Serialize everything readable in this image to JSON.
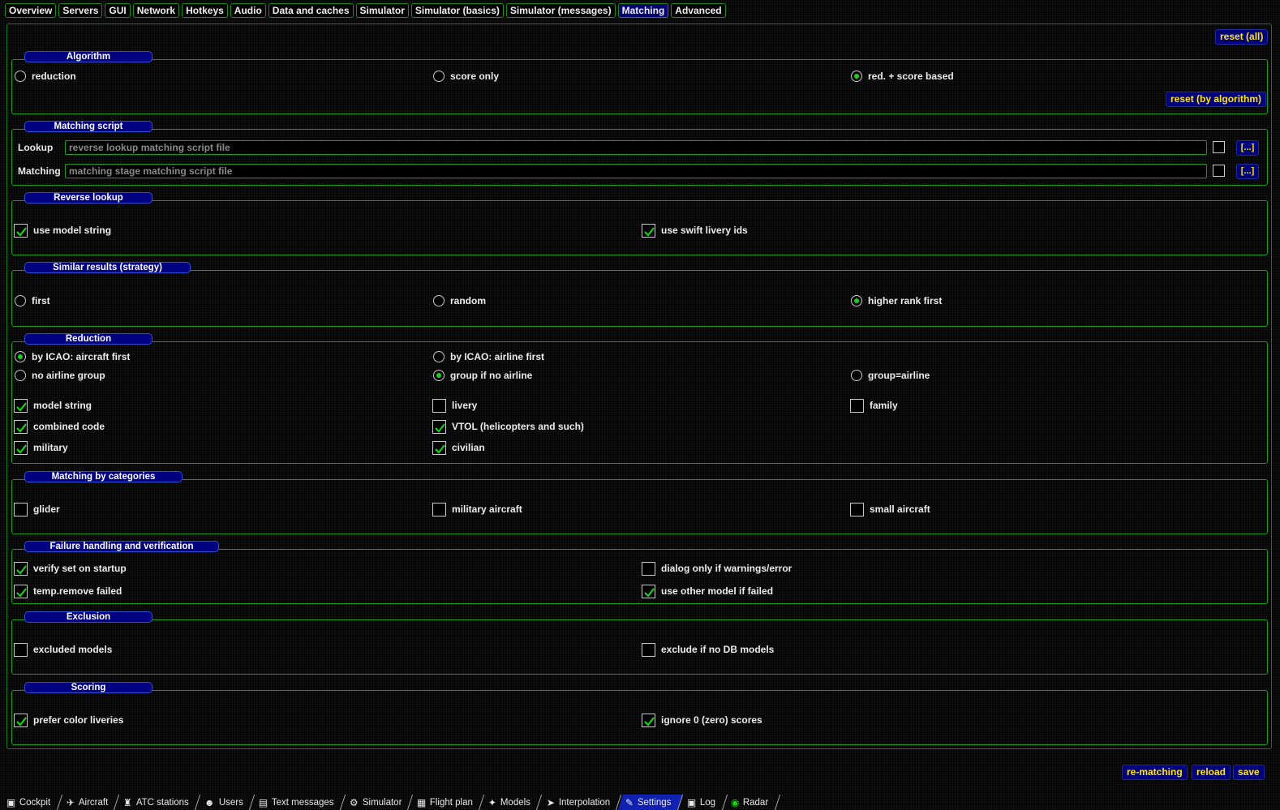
{
  "tabs": [
    "Overview",
    "Servers",
    "GUI",
    "Network",
    "Hotkeys",
    "Audio",
    "Data and caches",
    "Simulator",
    "Simulator (basics)",
    "Simulator (messages)",
    "Matching",
    "Advanced"
  ],
  "active_tab": "Matching",
  "buttons": {
    "reset_all": "reset (all)",
    "reset_by_algorithm": "reset (by algorithm)",
    "rematching": "re-matching",
    "reload": "reload",
    "save": "save",
    "browse": "[...]"
  },
  "algorithm": {
    "title": "Algorithm",
    "options": [
      {
        "label": "reduction",
        "selected": false
      },
      {
        "label": "score only",
        "selected": false
      },
      {
        "label": "red. + score based",
        "selected": true
      }
    ]
  },
  "matching_script": {
    "title": "Matching script",
    "lookup_label": "Lookup",
    "lookup_placeholder": "reverse lookup matching script file",
    "matching_label": "Matching",
    "matching_placeholder": "matching stage matching script file"
  },
  "reverse_lookup": {
    "title": "Reverse lookup",
    "options": [
      {
        "label": "use model string",
        "checked": true
      },
      {
        "label": "use swift livery ids",
        "checked": true
      }
    ]
  },
  "similar_results": {
    "title": "Similar results (strategy)",
    "options": [
      {
        "label": "first",
        "selected": false
      },
      {
        "label": "random",
        "selected": false
      },
      {
        "label": "higher rank first",
        "selected": true
      }
    ]
  },
  "reduction": {
    "title": "Reduction",
    "icao_options": [
      {
        "label": "by ICAO: aircraft first",
        "selected": true
      },
      {
        "label": "by ICAO: airline first",
        "selected": false
      }
    ],
    "group_options": [
      {
        "label": "no airline group",
        "selected": false
      },
      {
        "label": "group if no airline",
        "selected": true
      },
      {
        "label": "group=airline",
        "selected": false
      }
    ],
    "checks": [
      {
        "label": "model string",
        "checked": true
      },
      {
        "label": "livery",
        "checked": false
      },
      {
        "label": "family",
        "checked": false
      },
      {
        "label": "combined code",
        "checked": true
      },
      {
        "label": "VTOL (helicopters and such)",
        "checked": true
      },
      {
        "label": "military",
        "checked": true
      },
      {
        "label": "civilian",
        "checked": true
      }
    ]
  },
  "categories": {
    "title": "Matching by categories",
    "options": [
      {
        "label": "glider",
        "checked": false
      },
      {
        "label": "military aircraft",
        "checked": false
      },
      {
        "label": "small aircraft",
        "checked": false
      }
    ]
  },
  "failure": {
    "title": "Failure handling and verification",
    "options": [
      {
        "label": "verify set on startup",
        "checked": true
      },
      {
        "label": "dialog only if warnings/error",
        "checked": false
      },
      {
        "label": "temp.remove failed",
        "checked": true
      },
      {
        "label": "use other model if failed",
        "checked": true
      }
    ]
  },
  "exclusion": {
    "title": "Exclusion",
    "options": [
      {
        "label": "excluded models",
        "checked": false
      },
      {
        "label": "exclude if no DB models",
        "checked": false
      }
    ]
  },
  "scoring": {
    "title": "Scoring",
    "options": [
      {
        "label": "prefer color liveries",
        "checked": true
      },
      {
        "label": "ignore 0 (zero) scores",
        "checked": true
      }
    ]
  },
  "bottom_tabs": [
    {
      "label": "Cockpit",
      "icon": "cockpit-icon",
      "active": false
    },
    {
      "label": "Aircraft",
      "icon": "aircraft-icon",
      "active": false
    },
    {
      "label": "ATC stations",
      "icon": "atc-icon",
      "active": false
    },
    {
      "label": "Users",
      "icon": "users-icon",
      "active": false
    },
    {
      "label": "Text messages",
      "icon": "text-messages-icon",
      "active": false
    },
    {
      "label": "Simulator",
      "icon": "simulator-icon",
      "active": false
    },
    {
      "label": "Flight plan",
      "icon": "flight-plan-icon",
      "active": false
    },
    {
      "label": "Models",
      "icon": "models-icon",
      "active": false
    },
    {
      "label": "Interpolation",
      "icon": "interpolation-icon",
      "active": false
    },
    {
      "label": "Settings",
      "icon": "settings-icon",
      "active": true
    },
    {
      "label": "Log",
      "icon": "log-icon",
      "active": false
    },
    {
      "label": "Radar",
      "icon": "radar-icon",
      "active": false
    }
  ],
  "colors": {
    "background": "#050505",
    "border_green": "#1d9a1d",
    "button_blue": "#00007a",
    "button_text_yellow": "#ffe600",
    "check_green": "#19d119"
  }
}
